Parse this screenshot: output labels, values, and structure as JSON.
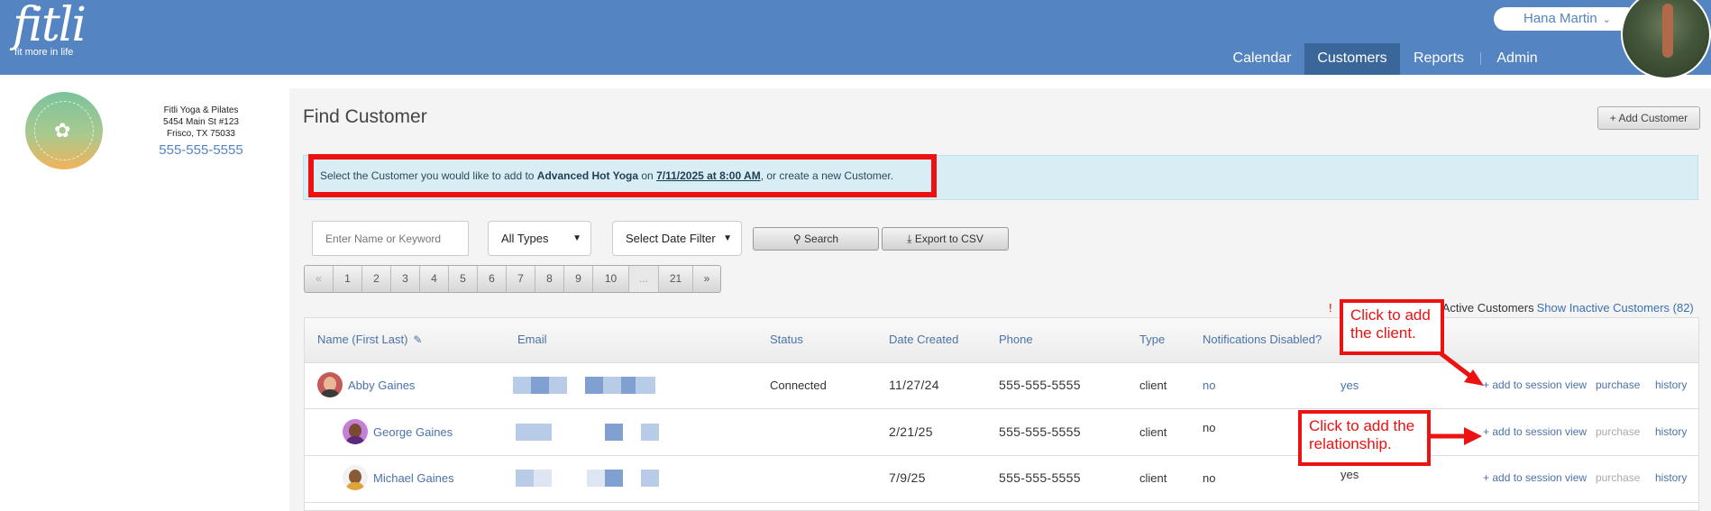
{
  "header": {
    "logo_text": "fitli",
    "logo_tagline": "fit more in life",
    "user_name": "Hana Martin",
    "nav": [
      {
        "label": "Calendar"
      },
      {
        "label": "Customers"
      },
      {
        "label": "Reports"
      },
      {
        "label": "Admin"
      }
    ]
  },
  "business": {
    "name": "Fitli Yoga & Pilates",
    "address_line1": "5454 Main St #123",
    "address_line2": "Frisco, TX 75033",
    "phone": "555-555-5555"
  },
  "page": {
    "title": "Find Customer",
    "add_customer_label": "+ Add Customer",
    "info": {
      "prefix": "Select the Customer you would like to add to ",
      "class_name": "Advanced Hot Yoga",
      "middle": " on ",
      "datetime": "7/11/2025 at 8:00 AM",
      "suffix": ", or create a new Customer."
    }
  },
  "filters": {
    "search_placeholder": "Enter Name or Keyword",
    "type_select": "All Types",
    "date_select": "Select Date Filter",
    "search_button": "Search",
    "export_button": "Export to CSV"
  },
  "pagination": {
    "prev": "«",
    "pages": [
      "1",
      "2",
      "3",
      "4",
      "5",
      "6",
      "7",
      "8",
      "9",
      "10"
    ],
    "gap": "...",
    "last": "21",
    "next": "»"
  },
  "counts": {
    "warn_icon": "!",
    "active_label": "1 Active Customers",
    "inactive_link": "Show Inactive Customers (82)"
  },
  "table": {
    "columns": [
      "Name (First Last)",
      "Email",
      "Status",
      "Date Created",
      "Phone",
      "Type",
      "Notifications Disabled?"
    ],
    "actions": {
      "add": "+ add to session view",
      "purchase": "purchase",
      "history": "history"
    },
    "rows": [
      {
        "name": "Abby Gaines",
        "status": "Connected",
        "date": "11/27/24",
        "phone": "555-555-5555",
        "type": "client",
        "notifications": "no",
        "extra": "yes"
      },
      {
        "name": "George Gaines",
        "status": "",
        "date": "2/21/25",
        "phone": "555-555-5555",
        "type": "client",
        "notifications": "no",
        "extra": ""
      },
      {
        "name": "Michael Gaines",
        "status": "",
        "date": "7/9/25",
        "phone": "555-555-5555",
        "type": "client",
        "notifications": "no",
        "extra": "yes"
      }
    ]
  },
  "annotations": {
    "callout_client_line1": "Click to add",
    "callout_client_line2": "the client.",
    "callout_rel_line1": "Click to add the",
    "callout_rel_line2": "relationship."
  },
  "colors": {
    "header": "#5484c1",
    "active_nav": "#3b6699",
    "annotation": "#ee1111",
    "link": "#4a72a8"
  }
}
